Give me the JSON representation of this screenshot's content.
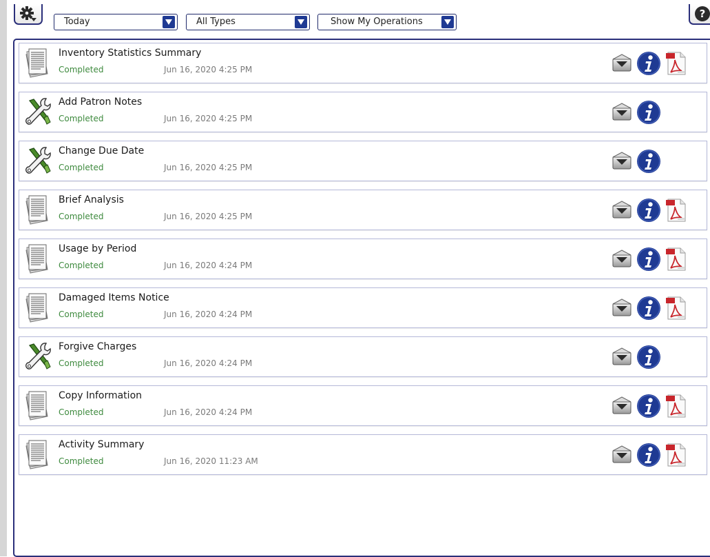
{
  "toolbar": {
    "gear_icon": "gear-icon",
    "help_icon": "help-icon",
    "help_glyph": "?",
    "date_filter": {
      "selected": "Today"
    },
    "type_filter": {
      "selected": "All Types"
    },
    "scope_filter": {
      "selected": "Show My Operations"
    }
  },
  "colors": {
    "accent": "#2a2f7a",
    "dropdown_arrow_bg": "#1f3a93",
    "status_completed": "#3e8a3e",
    "timestamp": "#7a7a7a",
    "info_badge": "#1f3a93",
    "pdf_red": "#c8252b"
  },
  "operations": [
    {
      "title": "Inventory Statistics Summary",
      "status": "Completed",
      "time": "Jun 16, 2020 4:25 PM",
      "icon": "report-document-icon",
      "has_pdf": true
    },
    {
      "title": "Add Patron Notes",
      "status": "Completed",
      "time": "Jun 16, 2020 4:25 PM",
      "icon": "tools-icon",
      "has_pdf": false
    },
    {
      "title": "Change Due Date",
      "status": "Completed",
      "time": "Jun 16, 2020 4:25 PM",
      "icon": "tools-icon",
      "has_pdf": false
    },
    {
      "title": "Brief Analysis",
      "status": "Completed",
      "time": "Jun 16, 2020 4:25 PM",
      "icon": "report-document-icon",
      "has_pdf": true
    },
    {
      "title": "Usage by Period",
      "status": "Completed",
      "time": "Jun 16, 2020 4:24 PM",
      "icon": "report-document-icon",
      "has_pdf": true
    },
    {
      "title": "Damaged Items Notice",
      "status": "Completed",
      "time": "Jun 16, 2020 4:24 PM",
      "icon": "report-document-icon",
      "has_pdf": true
    },
    {
      "title": "Forgive Charges",
      "status": "Completed",
      "time": "Jun 16, 2020 4:24 PM",
      "icon": "tools-icon",
      "has_pdf": false
    },
    {
      "title": "Copy Information",
      "status": "Completed",
      "time": "Jun 16, 2020 4:24 PM",
      "icon": "report-document-icon",
      "has_pdf": true
    },
    {
      "title": "Activity Summary",
      "status": "Completed",
      "time": "Jun 16, 2020 11:23 AM",
      "icon": "report-document-icon",
      "has_pdf": true
    }
  ]
}
